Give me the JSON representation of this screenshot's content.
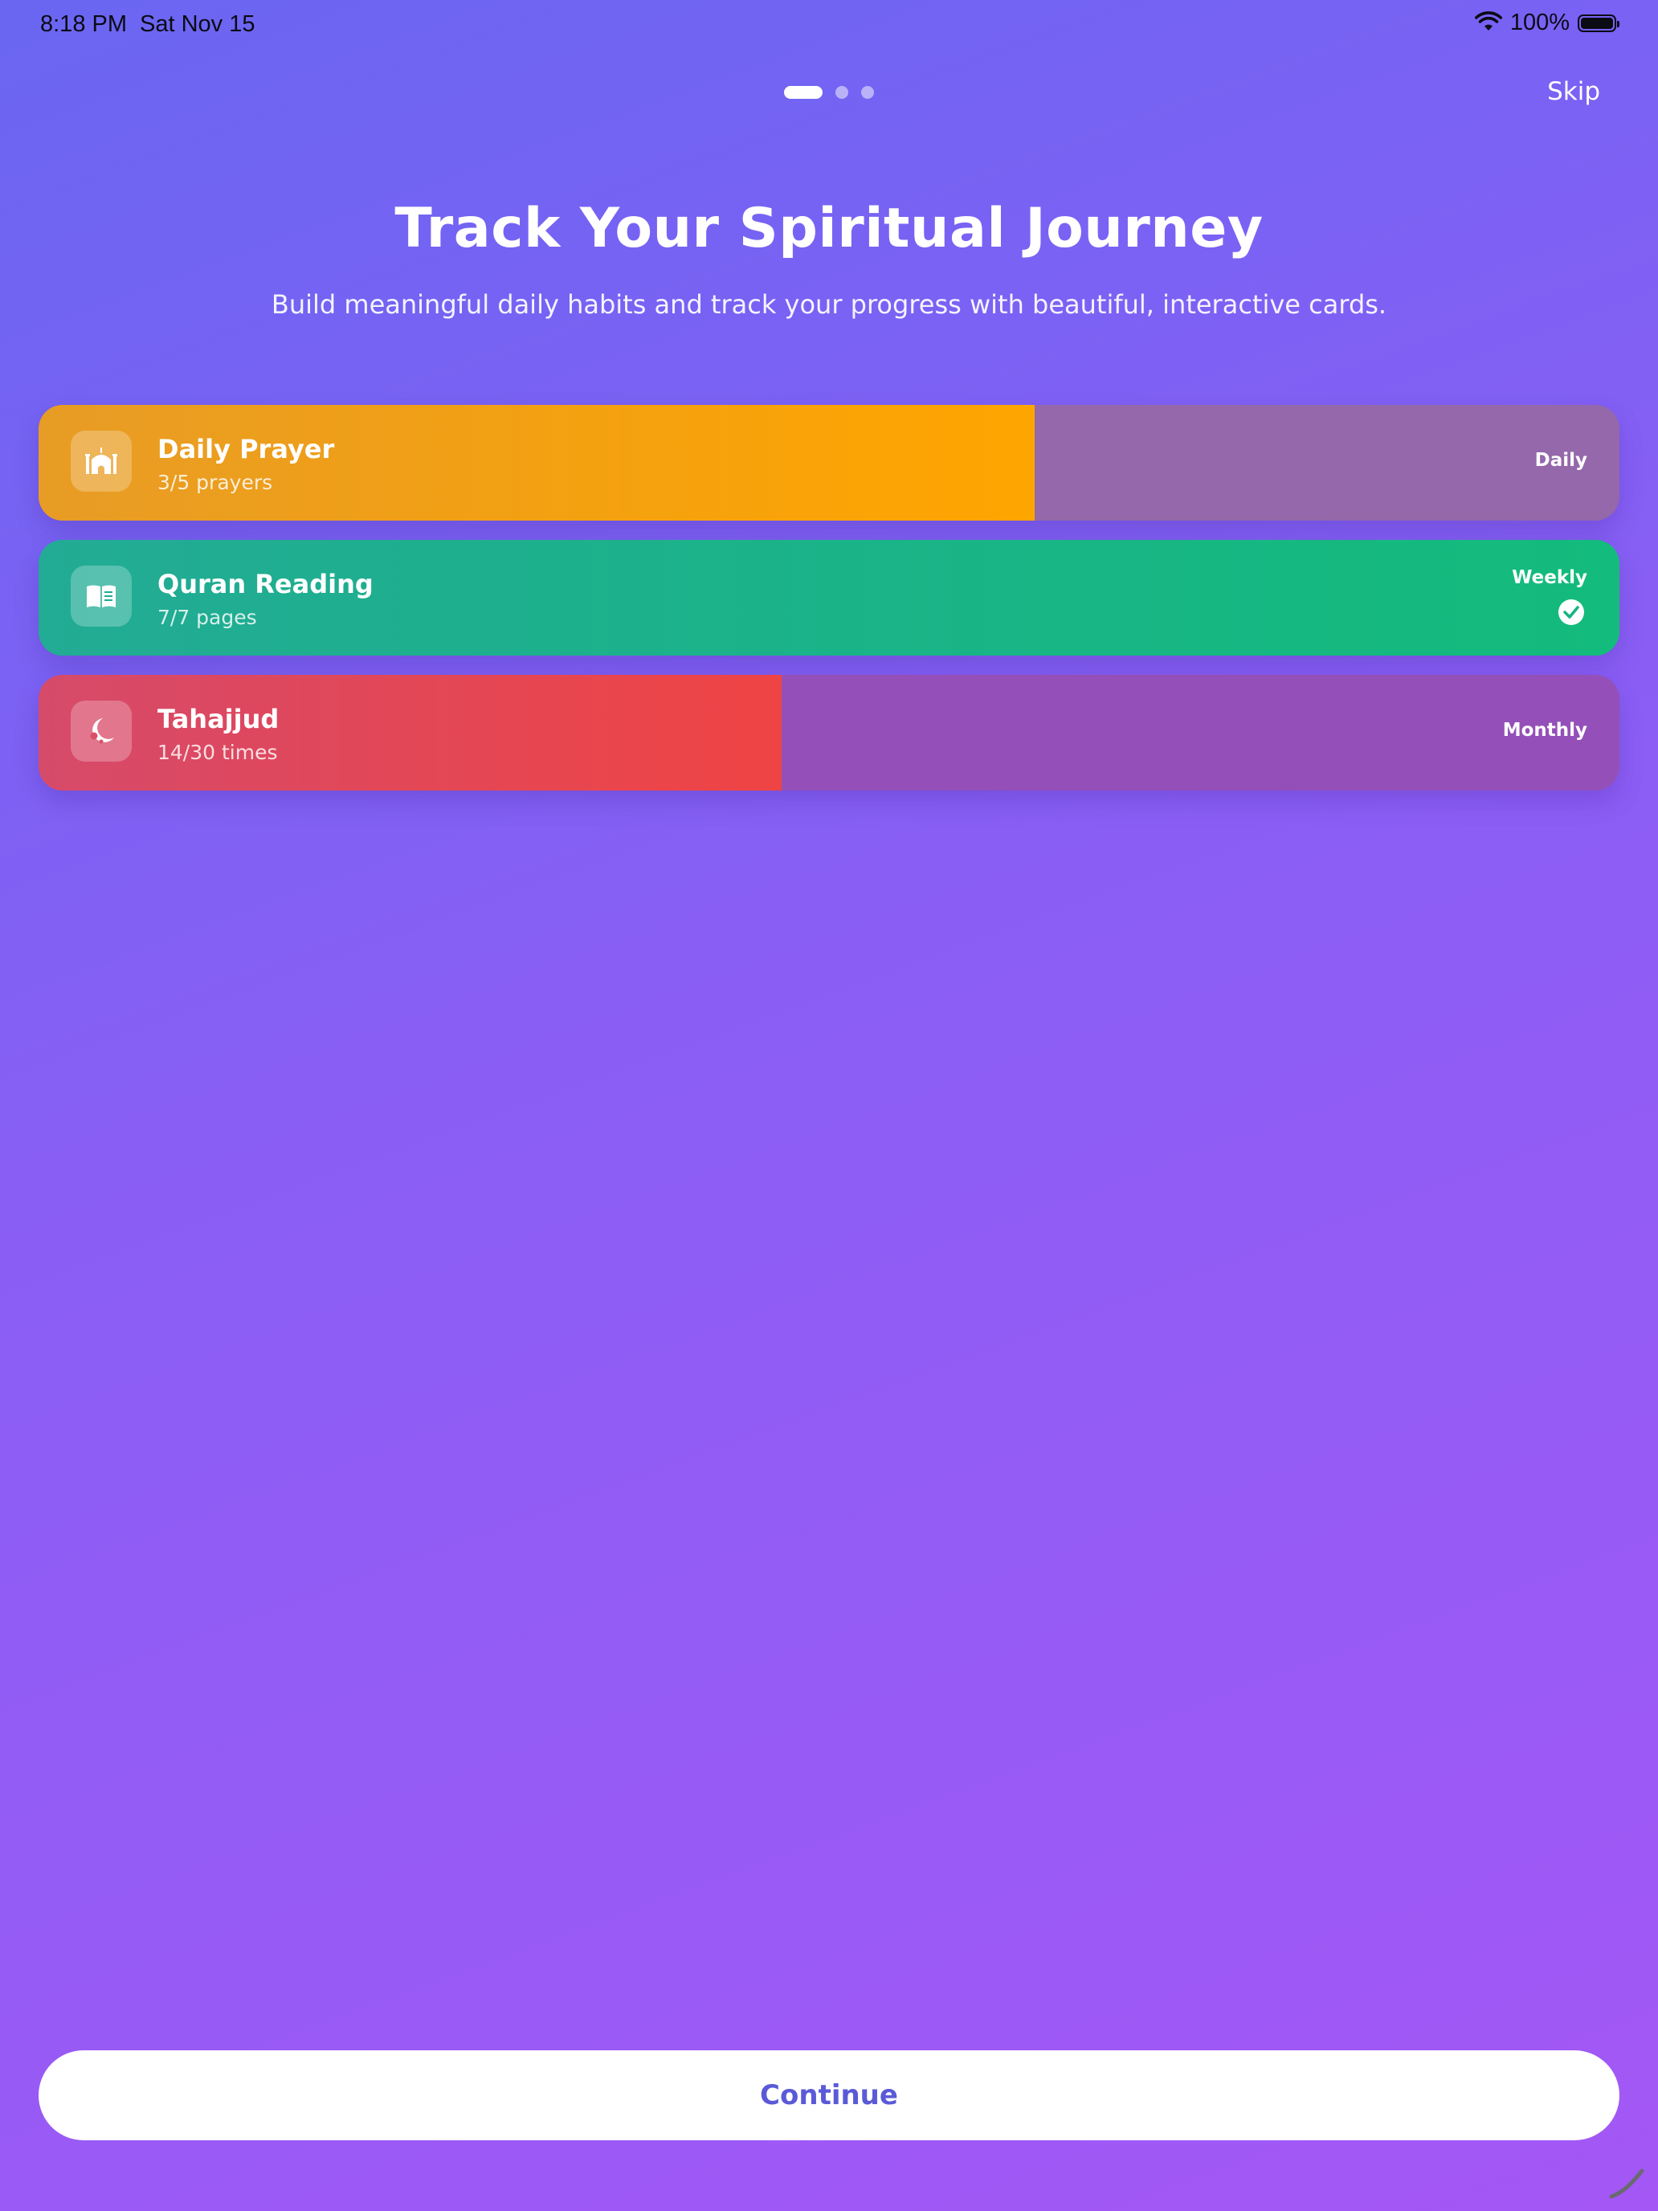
{
  "status_bar": {
    "time": "8:18 PM",
    "date": "Sat Nov 15",
    "battery_percent": "100%"
  },
  "pager": {
    "page_count": 3,
    "current_page": 1
  },
  "header": {
    "skip_label": "Skip",
    "title": "Track Your Spiritual Journey",
    "subtitle": "Build meaningful daily habits and track your progress with beautiful, interactive cards."
  },
  "cards": [
    {
      "title": "Daily Prayer",
      "subtitle": "3/5 prayers",
      "period": "Daily",
      "progress": 0.63,
      "complete": false,
      "icon": "mosque-icon",
      "color_start": "#e79c25",
      "color_end": "#ffa500",
      "track_color": "#9468aa"
    },
    {
      "title": "Quran Reading",
      "subtitle": "7/7 pages",
      "period": "Weekly",
      "progress": 1.0,
      "complete": true,
      "icon": "book-icon",
      "color_start": "#22ab95",
      "color_end": "#13bb7c",
      "track_color": "#1cb38a"
    },
    {
      "title": "Tahajjud",
      "subtitle": "14/30 times",
      "period": "Monthly",
      "progress": 0.47,
      "complete": false,
      "icon": "moon-star-icon",
      "color_start": "#d64a6a",
      "color_end": "#ef4444",
      "track_color": "#9450b8"
    }
  ],
  "footer": {
    "continue_label": "Continue"
  }
}
